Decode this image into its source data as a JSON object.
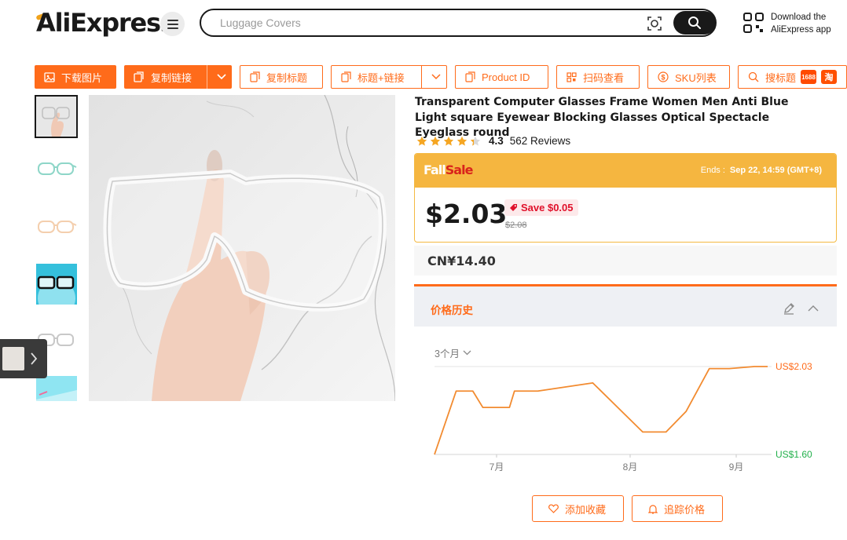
{
  "header": {
    "logo": "AliExpress",
    "search_placeholder": "Luggage Covers",
    "app_download": [
      "Download the",
      "AliExpress app"
    ]
  },
  "toolbar": {
    "download_image": "下载图片",
    "copy_link": "复制链接",
    "copy_title": "复制标题",
    "title_link": "标题+链接",
    "product_id": "Product ID",
    "scan_view": "扫码查看",
    "sku_list": "SKU列表",
    "search_title": "搜标题",
    "badge_1688": "1688",
    "badge_tao": "淘"
  },
  "product": {
    "title": "Transparent Computer Glasses Frame Women Men Anti Blue Light square Eyewear Blocking Glasses Optical Spectacle Eyeglass round",
    "rating": 4.3,
    "rating_text": "4.3",
    "reviews": "562 Reviews"
  },
  "sale": {
    "fall": "Fall",
    "sale": "Sale",
    "ends_label": "Ends :",
    "ends_value": "Sep 22, 14:59 (GMT+8)",
    "price": "$2.03",
    "save": "Save $0.05",
    "original_price": "$2.08",
    "cny": "CN¥14.40"
  },
  "history": {
    "title": "价格历史",
    "range": "3个月",
    "add_favorite": "添加收藏",
    "track_price": "追踪价格"
  },
  "chart_data": {
    "type": "line",
    "x_ticks": [
      "7月",
      "8月",
      "9月"
    ],
    "ylim": [
      1.6,
      2.03
    ],
    "y_tick_labels": [
      "US$2.03",
      "US$1.60"
    ],
    "values": [
      1.6,
      1.91,
      1.91,
      1.83,
      1.83,
      1.91,
      1.91,
      1.95,
      1.71,
      1.71,
      1.81,
      2.02,
      2.02,
      2.03,
      2.03
    ],
    "colors": {
      "line": "#f28b30",
      "high": "#ff6b1a",
      "low": "#22b04b"
    }
  }
}
